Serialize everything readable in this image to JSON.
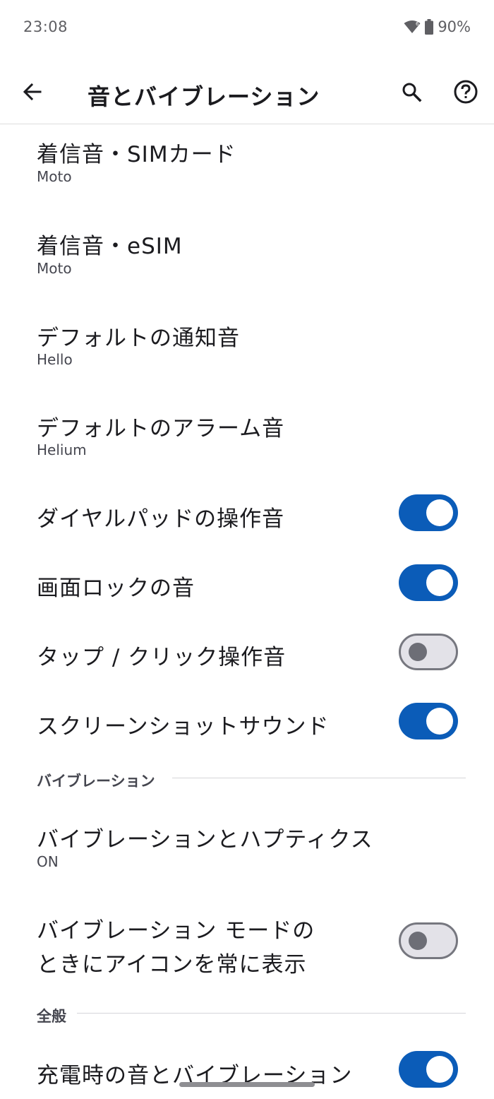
{
  "status_bar": {
    "time": "23:08",
    "battery_text": "90%",
    "icons": [
      "wifi-icon",
      "battery-icon"
    ]
  },
  "app_bar": {
    "title": "音とバイブレーション",
    "icons": [
      "back-arrow-icon",
      "search-icon",
      "help-icon"
    ]
  },
  "items": [
    {
      "title": "着信音・SIMカード",
      "summary": "Moto"
    },
    {
      "title": "着信音・eSIM",
      "summary": "Moto"
    },
    {
      "title": "デフォルトの通知音",
      "summary": "Hello"
    },
    {
      "title": "デフォルトのアラーム音",
      "summary": "Helium"
    }
  ],
  "toggles": [
    {
      "title": "ダイヤルパッドの操作音",
      "on": true
    },
    {
      "title": "画面ロックの音",
      "on": true
    },
    {
      "title": "タップ / クリック操作音",
      "on": false
    },
    {
      "title": "スクリーンショットサウンド",
      "on": true
    }
  ],
  "vibration_section": {
    "header": "バイブレーション",
    "haptics": {
      "title": "バイブレーションとハプティクス",
      "summary": "ON"
    },
    "always_show_icon": {
      "title_line1": "バイブレーション モードの",
      "title_line2": "ときにアイコンを常に表示",
      "on": false
    }
  },
  "general_section": {
    "header": "全般",
    "charging": {
      "title": "充電時の音とバイブレーション",
      "on": true
    }
  },
  "colors": {
    "toggle_on": "#0b5cb8",
    "toggle_off_track": "#e3e2e8",
    "toggle_off_knob": "#6d6e76"
  }
}
